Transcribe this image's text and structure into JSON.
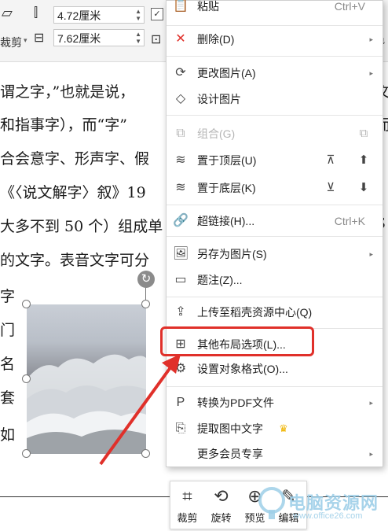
{
  "ribbon": {
    "height_value": "4.72厘米",
    "width_value": "7.62厘米",
    "crop_label": "裁剪"
  },
  "document": {
    "lines": [
      "谓之字，”也就是说，",
      "和指事字），而“字”",
      "合会意字、形声字、假",
      "《〈说文解字〉叙》19",
      "大多不到 50 个）组成单",
      "的文字。表音文字可分",
      "字",
      "门",
      "名",
      "套",
      "如"
    ],
    "right_edge": [
      "文",
      "而",
      "S"
    ]
  },
  "menu": {
    "paste": {
      "label": "粘贴",
      "shortcut": "Ctrl+V"
    },
    "delete": {
      "label": "删除(D)"
    },
    "change_picture": {
      "label": "更改图片(A)"
    },
    "design_picture": {
      "label": "设计图片"
    },
    "group": {
      "label": "组合(G)"
    },
    "bring_front": {
      "label": "置于顶层(U)"
    },
    "send_back": {
      "label": "置于底层(K)"
    },
    "hyperlink": {
      "label": "超链接(H)...",
      "shortcut": "Ctrl+K"
    },
    "save_as_picture": {
      "label": "另存为图片(S)"
    },
    "caption": {
      "label": "题注(Z)..."
    },
    "upload": {
      "label": "上传至稻壳资源中心(Q)"
    },
    "more_layout": {
      "label": "其他布局选项(L)..."
    },
    "format_object": {
      "label": "设置对象格式(O)..."
    },
    "to_pdf": {
      "label": "转换为PDF文件"
    },
    "extract_text": {
      "label": "提取图中文字"
    },
    "member_more": {
      "label": "更多会员专享"
    }
  },
  "bottom_toolbar": {
    "crop": "裁剪",
    "rotate": "旋转",
    "preview": "预览",
    "edit": "编辑"
  },
  "watermark": {
    "title": "电脑资源网",
    "url": "www.office26.com"
  },
  "colors": {
    "highlight": "#e0302a",
    "delete_icon": "#e0302a",
    "crown": "#f0b400"
  }
}
